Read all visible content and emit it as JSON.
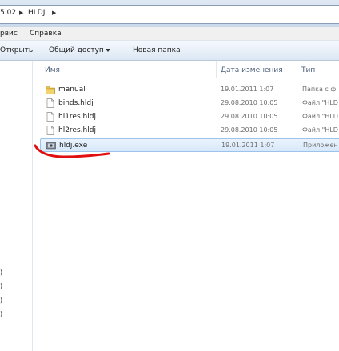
{
  "address_bar": {
    "crumbs": [
      "5.02",
      "HLDJ"
    ]
  },
  "menu_bar": {
    "items": [
      "рвис",
      "Справка"
    ]
  },
  "toolbar": {
    "open_label": "Открыть",
    "share_label": "Общий доступ",
    "new_folder_label": "Новая папка"
  },
  "columns": {
    "name": "Имя",
    "date": "Дата изменения",
    "type": "Тип"
  },
  "nav_pane": {
    "fragments": [
      ")",
      ")",
      ")",
      ")"
    ]
  },
  "files": [
    {
      "name": "manual",
      "date": "19.01.2011 1:07",
      "type": "Папка с ф",
      "icon": "folder-icon"
    },
    {
      "name": "binds.hldj",
      "date": "29.08.2010 10:05",
      "type": "Файл \"HLD",
      "icon": "file-icon"
    },
    {
      "name": "hl1res.hldj",
      "date": "29.08.2010 10:05",
      "type": "Файл \"HLD",
      "icon": "file-icon"
    },
    {
      "name": "hl2res.hldj",
      "date": "29.08.2010 10:05",
      "type": "Файл \"HLD",
      "icon": "file-icon"
    },
    {
      "name": "hldj.exe",
      "date": "19.01.2011 1:07",
      "type": "Приложен",
      "icon": "exe-icon",
      "selected": true
    }
  ],
  "colors": {
    "selection_bg": "#d7e8fb",
    "selection_border": "#9cc3eb",
    "annotation_red": "#e01010",
    "folder_yellow": "#e8c14a"
  }
}
